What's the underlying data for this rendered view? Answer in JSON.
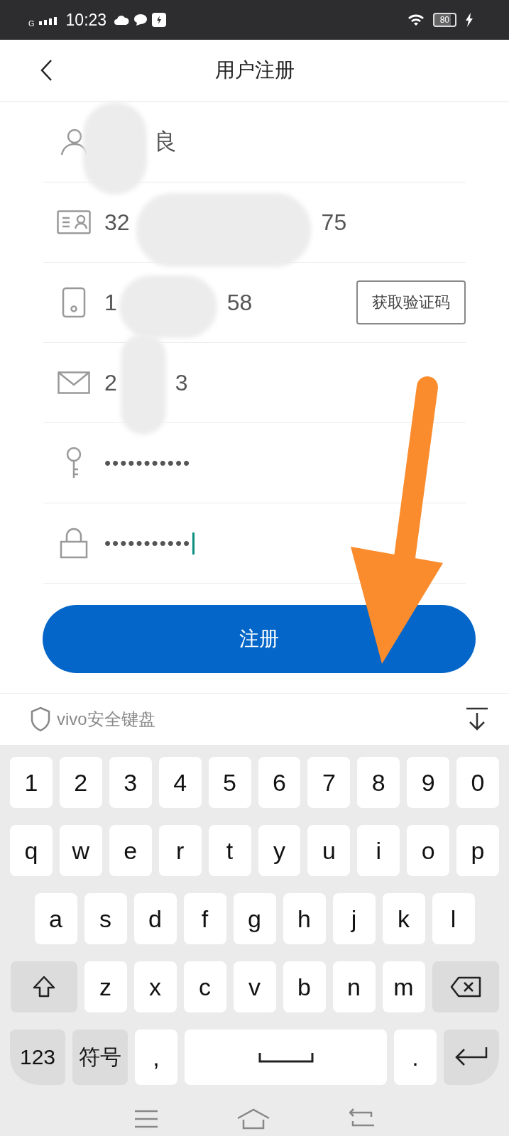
{
  "status_bar": {
    "network": "G",
    "time": "10:23",
    "battery": "80"
  },
  "header": {
    "title": "用户注册"
  },
  "fields": [
    {
      "kind": "text",
      "end": "良"
    },
    {
      "kind": "text",
      "start": "32",
      "end": "75"
    },
    {
      "kind": "text",
      "start": "1",
      "end": "58",
      "action": "获取验证码"
    },
    {
      "kind": "text",
      "start": "2",
      "end": "3"
    },
    {
      "kind": "password",
      "masked": "•••••••••••",
      "focused": false
    },
    {
      "kind": "password",
      "masked": "•••••••••••",
      "focused": true
    }
  ],
  "submit_button": "注册",
  "keyboard": {
    "title": "vivo安全键盘",
    "rows": [
      [
        {
          "kind": "char",
          "label": "1"
        },
        {
          "kind": "char",
          "label": "2"
        },
        {
          "kind": "char",
          "label": "3"
        },
        {
          "kind": "char",
          "label": "4"
        },
        {
          "kind": "char",
          "label": "5"
        },
        {
          "kind": "char",
          "label": "6"
        },
        {
          "kind": "char",
          "label": "7"
        },
        {
          "kind": "char",
          "label": "8"
        },
        {
          "kind": "char",
          "label": "9"
        },
        {
          "kind": "char",
          "label": "0"
        }
      ],
      [
        {
          "kind": "char",
          "label": "q"
        },
        {
          "kind": "char",
          "label": "w"
        },
        {
          "kind": "char",
          "label": "e"
        },
        {
          "kind": "char",
          "label": "r"
        },
        {
          "kind": "char",
          "label": "t"
        },
        {
          "kind": "char",
          "label": "y"
        },
        {
          "kind": "char",
          "label": "u"
        },
        {
          "kind": "char",
          "label": "i"
        },
        {
          "kind": "char",
          "label": "o"
        },
        {
          "kind": "char",
          "label": "p"
        }
      ],
      [
        {
          "kind": "char",
          "label": "a"
        },
        {
          "kind": "char",
          "label": "s"
        },
        {
          "kind": "char",
          "label": "d"
        },
        {
          "kind": "char",
          "label": "f"
        },
        {
          "kind": "char",
          "label": "g"
        },
        {
          "kind": "char",
          "label": "h"
        },
        {
          "kind": "char",
          "label": "j"
        },
        {
          "kind": "char",
          "label": "k"
        },
        {
          "kind": "char",
          "label": "l"
        }
      ],
      [
        {
          "kind": "shift"
        },
        {
          "kind": "char",
          "label": "z"
        },
        {
          "kind": "char",
          "label": "x"
        },
        {
          "kind": "char",
          "label": "c"
        },
        {
          "kind": "char",
          "label": "v"
        },
        {
          "kind": "char",
          "label": "b"
        },
        {
          "kind": "char",
          "label": "n"
        },
        {
          "kind": "char",
          "label": "m"
        },
        {
          "kind": "backspace"
        }
      ],
      [
        {
          "kind": "function",
          "label": "123"
        },
        {
          "kind": "function",
          "label": "符号"
        },
        {
          "kind": "char",
          "label": ","
        },
        {
          "kind": "space"
        },
        {
          "kind": "char",
          "label": "."
        },
        {
          "kind": "enter"
        }
      ]
    ]
  }
}
